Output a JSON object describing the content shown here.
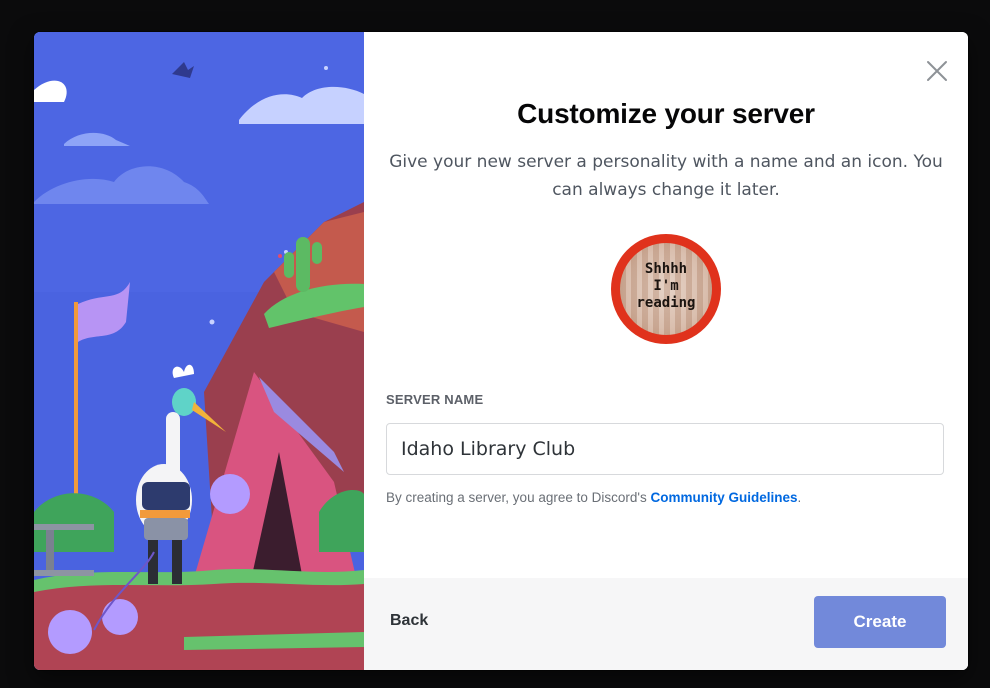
{
  "dialog": {
    "title": "Customize your server",
    "subtitle": "Give your new server a personality with a name and an icon. You can always change it later.",
    "close_icon": "close-icon"
  },
  "server_icon": {
    "text": "Shhhh\nI'm\nreading",
    "ring_color": "#e0321c"
  },
  "server_name": {
    "label": "SERVER NAME",
    "value": "Idaho Library Club"
  },
  "legal": {
    "prefix": "By creating a server, you agree to Discord's ",
    "link": "Community Guidelines",
    "suffix": "."
  },
  "footer": {
    "back_label": "Back",
    "create_label": "Create",
    "create_color": "#7289da"
  }
}
